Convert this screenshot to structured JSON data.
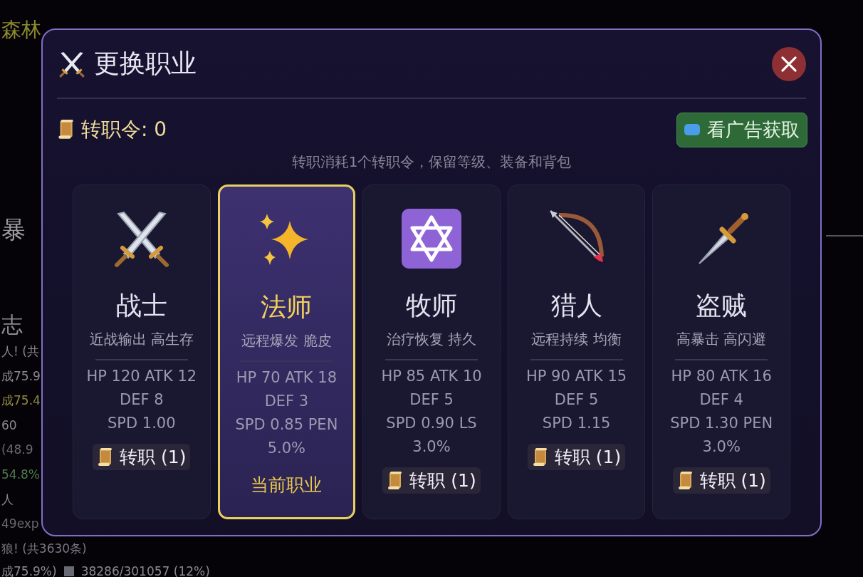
{
  "background": {
    "area_title": "森林",
    "heading": "暴",
    "log_title": "志",
    "log_lines": [
      {
        "text": "人! (共",
        "color": "#8a8890"
      },
      {
        "text": "成75.9",
        "color": "#8a8890"
      },
      {
        "text": "成75.4",
        "color": "#8c8a40"
      },
      {
        "text": "60",
        "color": "#8a8890"
      },
      {
        "text": "(48.9",
        "color": "#6a6872"
      },
      {
        "text": "54.8%",
        "color": "#4e7a50"
      },
      {
        "text": "人",
        "color": "#8a8890"
      },
      {
        "text": "49exp",
        "color": "#6a6872"
      },
      {
        "text": "狼! (共3630条)",
        "color": "#7a7882"
      }
    ],
    "footer": {
      "left": "成75.9%)",
      "right": "38286/301057 (12%)"
    }
  },
  "dialog": {
    "title": "更换职业",
    "tokens": "转职令: 0",
    "ad_button": "看广告获取",
    "note": "转职消耗1个转职令，保留等级、装备和背包",
    "classes": [
      {
        "kind": "swords",
        "name": "战士",
        "tags": "近战输出 高生存",
        "stats": [
          "HP 120 ATK 12",
          "DEF 8",
          "SPD 1.00"
        ],
        "selected": false,
        "action": "转职 (1)"
      },
      {
        "kind": "sparkles",
        "name": "法师",
        "tags": "远程爆发 脆皮",
        "stats": [
          "HP 70 ATK 18",
          "DEF 3",
          "SPD 0.85 PEN",
          "5.0%"
        ],
        "selected": true,
        "action": "当前职业"
      },
      {
        "kind": "star",
        "name": "牧师",
        "tags": "治疗恢复 持久",
        "stats": [
          "HP 85 ATK 10",
          "DEF 5",
          "SPD 0.90 LS",
          "3.0%"
        ],
        "selected": false,
        "action": "转职 (1)"
      },
      {
        "kind": "bow",
        "name": "猎人",
        "tags": "远程持续 均衡",
        "stats": [
          "HP 90 ATK 15",
          "DEF 5",
          "SPD 1.15"
        ],
        "selected": false,
        "action": "转职 (1)"
      },
      {
        "kind": "dagger",
        "name": "盗贼",
        "tags": "高暴击 高闪避",
        "stats": [
          "HP 80 ATK 16",
          "DEF 4",
          "SPD 1.30 PEN",
          "3.0%"
        ],
        "selected": false,
        "action": "转职 (1)"
      }
    ]
  }
}
